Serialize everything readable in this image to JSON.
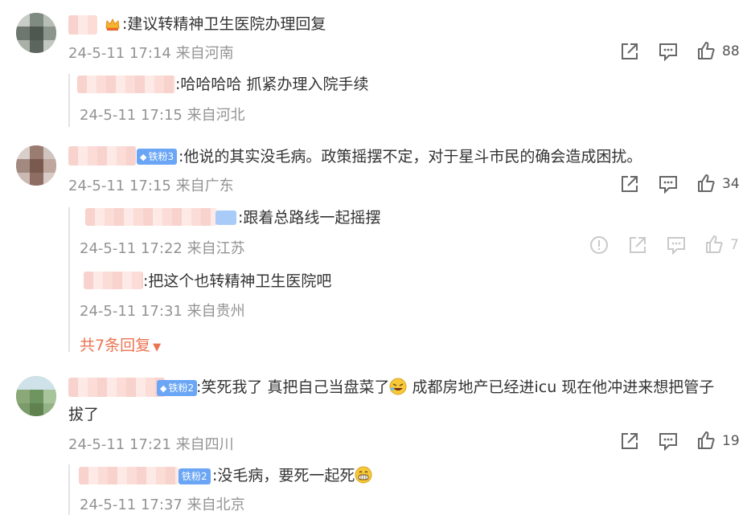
{
  "comments": [
    {
      "text": ":建议转精神卫生医院办理回复",
      "time": "24-5-11 17:14",
      "location": "来自河南",
      "likes": "88",
      "badge_icon": "crown-icon",
      "replies": [
        {
          "text": ":哈哈哈哈 抓紧办理入院手续",
          "time": "24-5-11 17:15",
          "location": "来自河北"
        }
      ]
    },
    {
      "text": ":他说的其实没毛病。政策摇摆不定，对于星斗市民的确会造成困扰。",
      "time": "24-5-11 17:15",
      "location": "来自广东",
      "likes": "34",
      "badge": "铁粉3",
      "replies": [
        {
          "text": ":跟着总路线一起摇摆",
          "time": "24-5-11 17:22",
          "location": "来自江苏",
          "likes": "7"
        },
        {
          "text": ":把这个也转精神卫生医院吧",
          "time": "24-5-11 17:31",
          "location": "来自贵州"
        }
      ],
      "more_replies": "共7条回复"
    },
    {
      "text_part1": ":笑死我了 真把自己当盘菜了",
      "text_part2": " 成都房地产已经进icu 现在他冲进来想把管子",
      "text_line2": "拔了",
      "time": "24-5-11 17:21",
      "location": "来自四川",
      "likes": "19",
      "badge": "铁粉2",
      "replies": [
        {
          "text": ":没毛病，要死一起死",
          "time": "24-5-11 17:37",
          "location": "来自北京",
          "badge": "铁粉2"
        }
      ]
    }
  ],
  "colors": {
    "meta": "#939393",
    "accent": "#eb7350",
    "badge": "#6aa6f5"
  }
}
